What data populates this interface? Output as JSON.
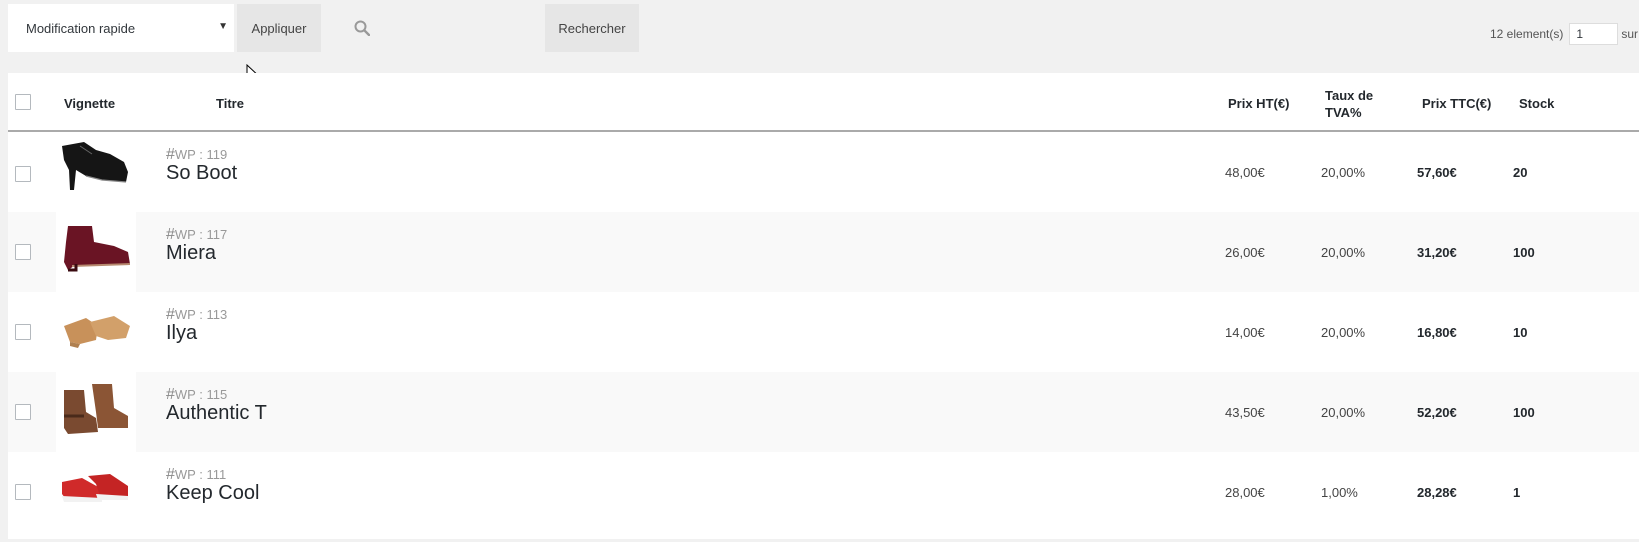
{
  "toolbar": {
    "bulk_action_selected": "Modification rapide",
    "apply_label": "Appliquer",
    "search_value": "",
    "search_label": "Rechercher"
  },
  "pagination": {
    "count_text": "12 element(s)",
    "page_value": "1",
    "sur_text": "sur"
  },
  "table": {
    "headers": {
      "thumbnail": "Vignette",
      "title": "Titre",
      "price_ht": "Prix HT(€)",
      "vat_line1": "Taux de",
      "vat_line2": "TVA%",
      "price_ttc": "Prix TTC(€)",
      "stock": "Stock"
    },
    "rows": [
      {
        "wp_id": "WP : 119",
        "title": "So Boot",
        "price_ht": "48,00€",
        "vat": "20,00%",
        "price_ttc": "57,60€",
        "stock": "20"
      },
      {
        "wp_id": "WP : 117",
        "title": "Miera",
        "price_ht": "26,00€",
        "vat": "20,00%",
        "price_ttc": "31,20€",
        "stock": "100"
      },
      {
        "wp_id": "WP : 113",
        "title": "Ilya",
        "price_ht": "14,00€",
        "vat": "20,00%",
        "price_ttc": "16,80€",
        "stock": "10"
      },
      {
        "wp_id": "WP : 115",
        "title": "Authentic T",
        "price_ht": "43,50€",
        "vat": "20,00%",
        "price_ttc": "52,20€",
        "stock": "100"
      },
      {
        "wp_id": "WP : 111",
        "title": "Keep Cool",
        "price_ht": "28,00€",
        "vat": "1,00%",
        "price_ttc": "28,28€",
        "stock": "1"
      }
    ]
  },
  "icons": {
    "search": "search-icon",
    "caret": "caret-down-icon",
    "cursor": "mouse-pointer-icon"
  }
}
